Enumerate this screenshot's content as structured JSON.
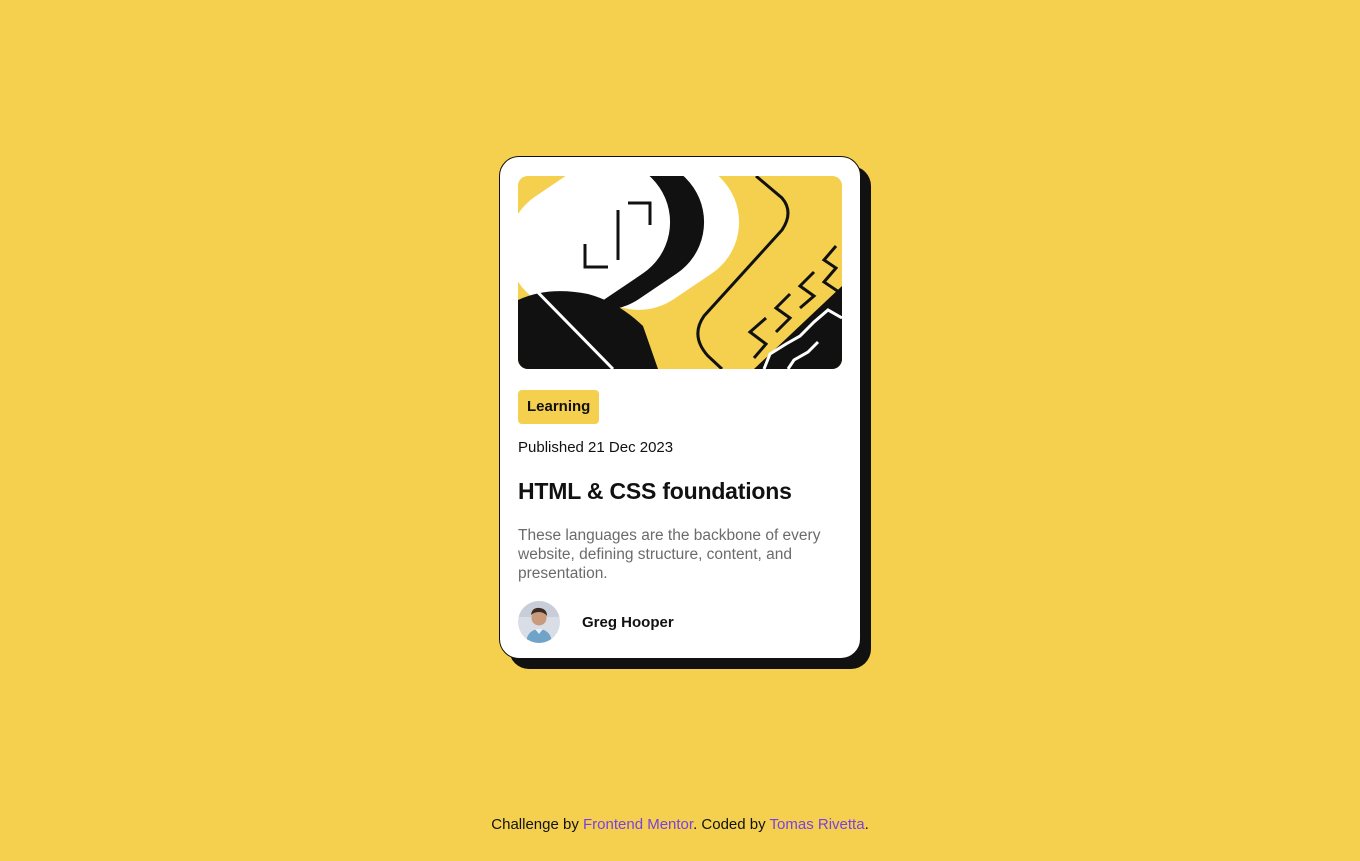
{
  "card": {
    "hero_icon": "illustration-article",
    "tag": "Learning",
    "published": "Published 21 Dec 2023",
    "title": "HTML & CSS foundations",
    "description": "These languages are the backbone of every website, defining structure, content, and presentation.",
    "author": {
      "name": "Greg Hooper",
      "avatar_icon": "avatar-image"
    }
  },
  "footer": {
    "prefix": "Challenge by ",
    "link1": "Frontend Mentor",
    "middle": ". Coded by ",
    "link2": "Tomas Rivetta",
    "suffix": "."
  },
  "colors": {
    "background": "#F4D04E",
    "text": "#111111",
    "muted": "#6B6B6B",
    "link": "#7B3FE4",
    "card": "#FFFFFF"
  }
}
